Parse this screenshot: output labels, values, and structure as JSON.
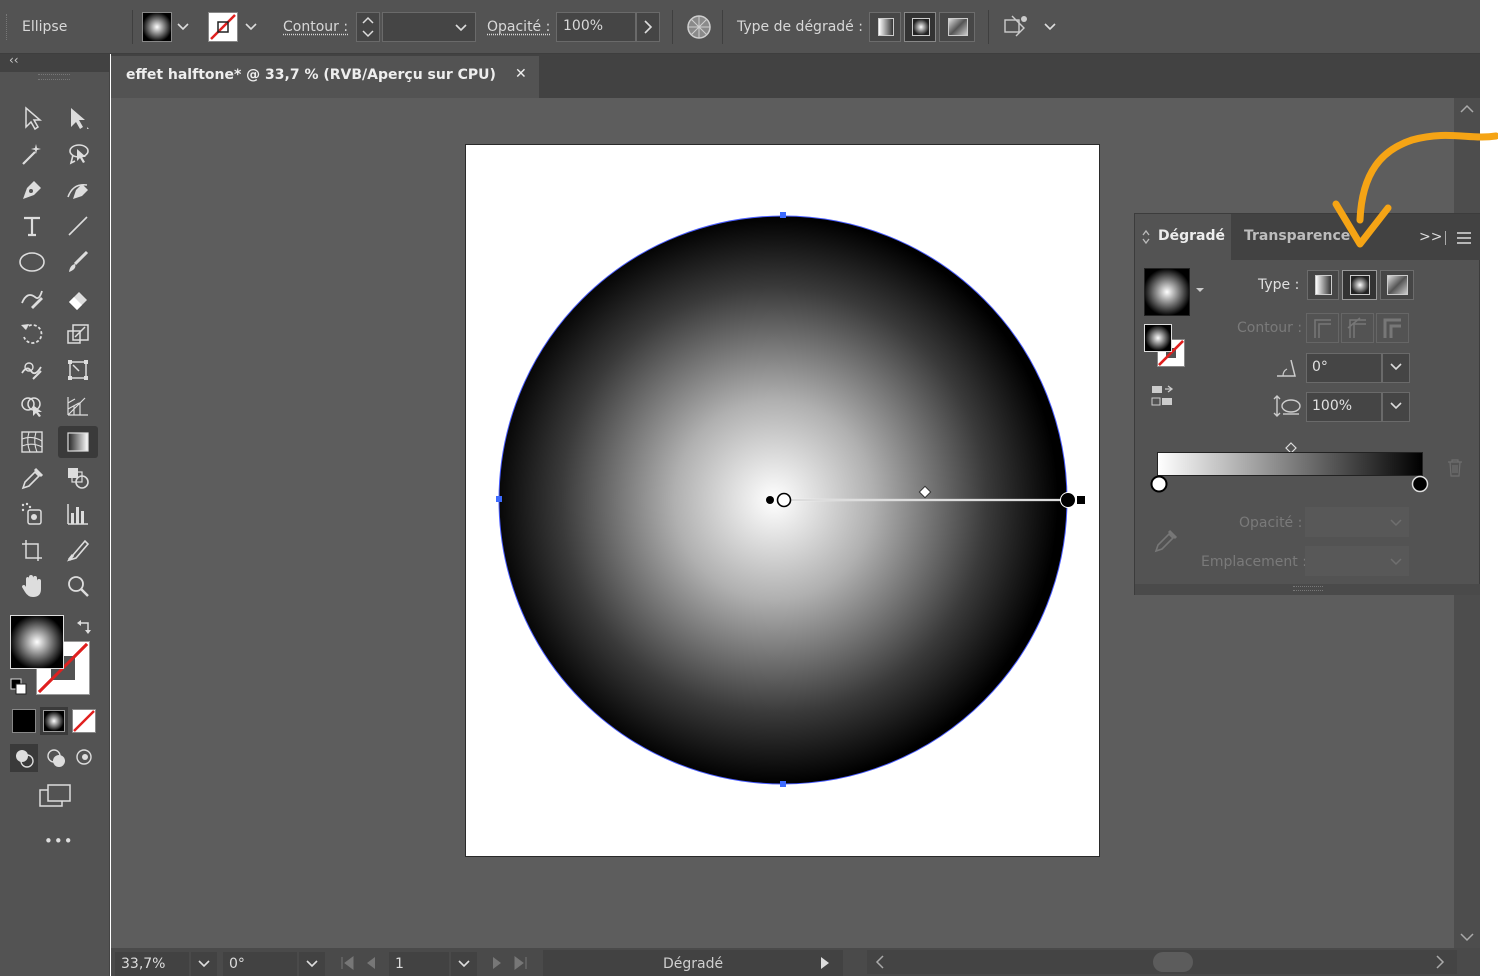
{
  "control_bar": {
    "object_type": "Ellipse",
    "contour_label": "Contour :",
    "opacity_label": "Opacité :",
    "opacity_value": "100%",
    "gradient_type_label": "Type de dégradé :"
  },
  "document_tab": {
    "title": "effet halftone* @ 33,7 % (RVB/Aperçu sur CPU)",
    "close_glyph": "✕"
  },
  "gradient_panel": {
    "tabs": [
      "Dégradé",
      "Transparence"
    ],
    "active_tab": "Dégradé",
    "collapse_glyph": ">>",
    "type_label": "Type :",
    "contour_label": "Contour :",
    "angle_value": "0°",
    "aspect_value": "100%",
    "opacity_label": "Opacité :",
    "location_label": "Emplacement :",
    "active_type": "radial"
  },
  "status_bar": {
    "zoom": "33,7%",
    "rotation": "0°",
    "artboard_number": "1",
    "current_tool": "Dégradé"
  },
  "toolbar": {
    "more_glyph": "•••",
    "selected_tool": "gradient-tool"
  },
  "colors": {
    "ui_dark": "#535353",
    "canvas": "#5d5d5d",
    "selection_blue": "#3d6bff",
    "annotation_orange": "#f5a415"
  }
}
